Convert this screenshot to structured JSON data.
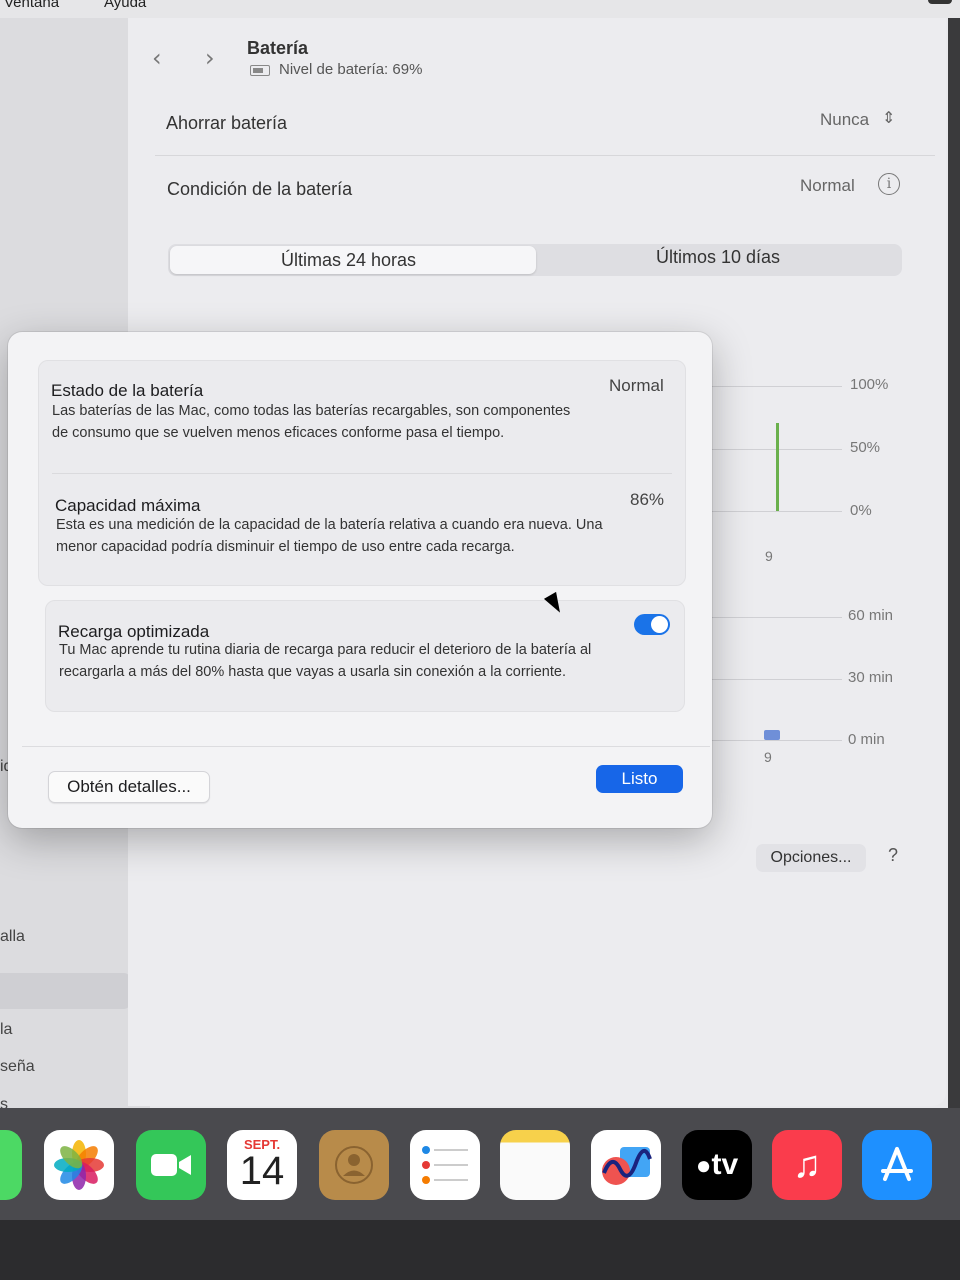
{
  "menubar": {
    "items": [
      "Ventana",
      "Ayuda"
    ]
  },
  "sidebar": {
    "fragments": [
      "ida",
      "alla",
      "la",
      "seña",
      "s"
    ]
  },
  "header": {
    "title": "Batería",
    "subtitle": "Nivel de batería: 69%"
  },
  "settings": {
    "save_label": "Ahorrar batería",
    "save_value": "Nunca",
    "health_label": "Condición de la batería",
    "health_value": "Normal"
  },
  "segments": {
    "items": [
      "Últimas 24 horas",
      "Últimos 10 días"
    ]
  },
  "chart": {
    "top_axis": [
      "100%",
      "50%",
      "0%"
    ],
    "top_tick": "9",
    "bottom_axis": [
      "60 min",
      "30 min",
      "0 min"
    ],
    "bottom_tick": "9"
  },
  "chart_data": [
    {
      "type": "bar",
      "ylim": [
        0,
        100
      ],
      "y_ticks": [
        "100%",
        "50%",
        "0%"
      ],
      "x_ticks": [
        "9"
      ],
      "values": [
        100
      ],
      "color": "#6ab04c"
    },
    {
      "type": "bar",
      "ylim": [
        0,
        60
      ],
      "y_ticks": [
        "60 min",
        "30 min",
        "0 min"
      ],
      "x_ticks": [
        "9"
      ],
      "values": [
        4
      ],
      "color": "#6f8fd8"
    }
  ],
  "footer": {
    "options_label": "Opciones...",
    "help_label": "?"
  },
  "modal": {
    "status_title": "Estado de la batería",
    "status_value": "Normal",
    "status_desc": "Las baterías de las Mac, como todas las baterías recargables, son componentes de consumo que se vuelven menos eficaces conforme pasa el tiempo.",
    "capacity_title": "Capacidad máxima",
    "capacity_value": "86%",
    "capacity_desc": "Esta es una medición de la capacidad de la batería relativa a cuando era nueva. Una menor capacidad podría disminuir el tiempo de uso entre cada recarga.",
    "optimized_title": "Recarga optimizada",
    "optimized_enabled": true,
    "optimized_desc": "Tu Mac aprende tu rutina diaria de recarga para reducir el deterioro de la batería al recargarla a más del 80% hasta que vayas a usarla sin conexión a la corriente.",
    "details_label": "Obtén detalles...",
    "done_label": "Listo"
  },
  "dock": {
    "calendar_month": "SEPT.",
    "calendar_day": "14",
    "tv_label": "tv",
    "icons": [
      "messages-icon",
      "photos-icon",
      "facetime-icon",
      "calendar-icon",
      "contacts-icon",
      "reminders-icon",
      "notes-icon",
      "freeform-icon",
      "apple-tv-icon",
      "music-icon",
      "app-store-icon"
    ]
  }
}
